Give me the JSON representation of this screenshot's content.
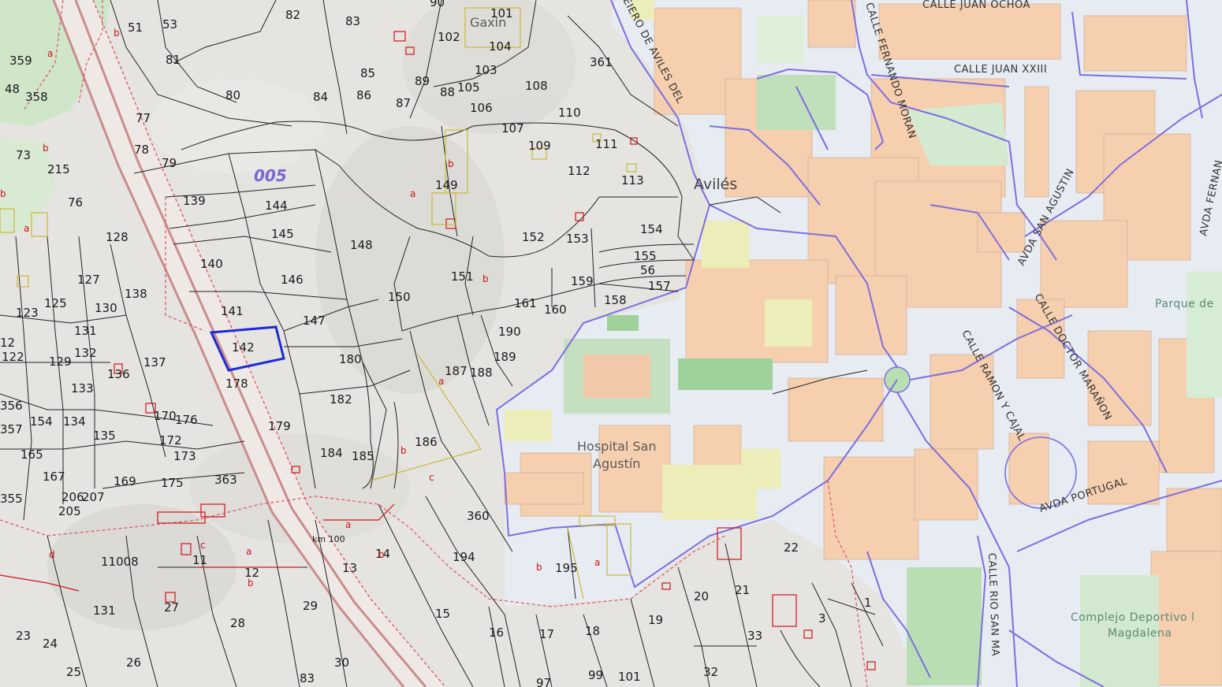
{
  "map": {
    "colors": {
      "terrain": "#e5e4e0",
      "urban_bg": "#e7ecf2",
      "building": "#f6cfae",
      "green": "#cfe6c9",
      "sports": "#a8d4a0",
      "yellow_block": "#ecedb8",
      "boundary": "#7e6ee0",
      "parcel_line": "#222222",
      "sub_line": "#d0141a",
      "selected": "#1d2bd6"
    },
    "labels": {
      "town": "Avilés",
      "hospital_1": "Hospital San",
      "hospital_2": "Agustín",
      "park": "Parque de",
      "sport_1": "Complejo Deportivo l",
      "sport_2": "Magdalena",
      "zone": "005",
      "place": "Gaxin",
      "km": "km 100"
    },
    "streets": {
      "fernando_moran": "CALLE FERNANDO MORAN",
      "juan_xxiii": "CALLE JUAN XXIII",
      "juan_ochoa": "CALLE JUAN OCHOA",
      "san_agustin": "AVDA SAN AGUSTIN",
      "doctor_maranon": "CALLE DOCTOR MARAÑON",
      "ramon_cajal": "CALLE RAMON Y CAJAL",
      "portugal": "AVDA PORTUGAL",
      "rio_san": "CALLE RIO SAN MA",
      "fernan": "AVDA FERNAN",
      "aviles_del": "EIERO DE AVILES DEL"
    },
    "selected_parcel": "142",
    "parcels": [
      "359",
      "358",
      "48",
      "73",
      "215",
      "76",
      "51",
      "53",
      "82",
      "83",
      "90",
      "101",
      "102",
      "104",
      "103",
      "81",
      "80",
      "84",
      "85",
      "86",
      "87",
      "89",
      "88",
      "105",
      "106",
      "108",
      "107",
      "110",
      "109",
      "111",
      "112",
      "361",
      "77",
      "78",
      "79",
      "139",
      "144",
      "145",
      "148",
      "149",
      "152",
      "153",
      "154",
      "113",
      "140",
      "146",
      "150",
      "151",
      "155",
      "56",
      "157",
      "158",
      "159",
      "161",
      "160",
      "141",
      "147",
      "142",
      "190",
      "189",
      "180",
      "187",
      "188",
      "178",
      "182",
      "179",
      "186",
      "184",
      "185",
      "137",
      "138",
      "130",
      "131",
      "132",
      "133",
      "136",
      "134",
      "135",
      "127",
      "125",
      "123",
      "128",
      "12",
      "129",
      "170",
      "176",
      "172",
      "173",
      "175",
      "169",
      "363",
      "165",
      "167",
      "205",
      "206",
      "207",
      "11008",
      "11",
      "12",
      "13",
      "14",
      "194",
      "195",
      "360",
      "22",
      "20",
      "21",
      "19",
      "18",
      "17",
      "16",
      "15",
      "29",
      "28",
      "27",
      "26",
      "25",
      "24",
      "23",
      "30",
      "32",
      "33",
      "99",
      "97",
      "101",
      "83",
      "3",
      "1",
      "131",
      "356",
      "357",
      "355",
      "154",
      "122"
    ],
    "subs": [
      "a",
      "b",
      "c",
      "d"
    ]
  }
}
